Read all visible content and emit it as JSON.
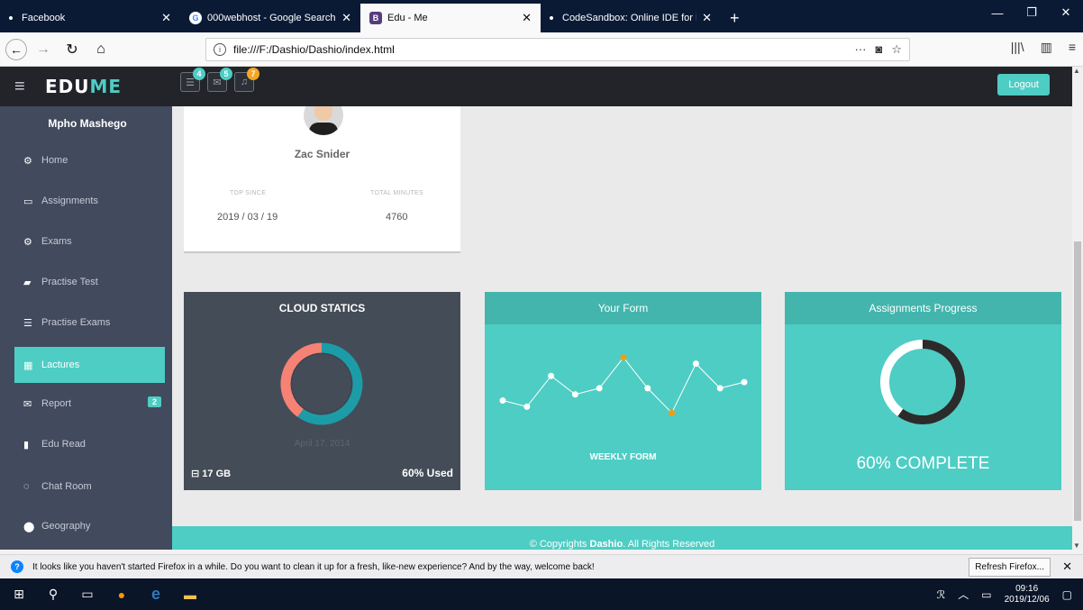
{
  "browser": {
    "tabs": [
      {
        "title": "Facebook",
        "active": false
      },
      {
        "title": "000webhost - Google Search",
        "active": false
      },
      {
        "title": "Edu - Me",
        "active": true
      },
      {
        "title": "CodeSandbox: Online IDE for R",
        "active": false
      }
    ],
    "url": "file:///F:/Dashio/Dashio/index.html"
  },
  "app": {
    "logo_main": "EDU",
    "logo_accent": "ME",
    "notifications": [
      {
        "icon": "tasks-icon",
        "count": "4",
        "color": "#4ecdc4"
      },
      {
        "icon": "envelope-icon",
        "count": "5",
        "color": "#4ecdc4"
      },
      {
        "icon": "bell-icon",
        "count": "7",
        "color": "#f5a623"
      }
    ],
    "logout_label": "Logout"
  },
  "sidebar": {
    "user_name": "Mpho Mashego",
    "items": [
      {
        "label": "Home",
        "icon": "dashboard-icon",
        "glyph": "⚙",
        "active": false
      },
      {
        "label": "Assignments",
        "icon": "desktop-icon",
        "glyph": "▭",
        "active": false
      },
      {
        "label": "Exams",
        "icon": "cogs-icon",
        "glyph": "⚙",
        "active": false
      },
      {
        "label": "Practise Test",
        "icon": "book-icon",
        "glyph": "▰",
        "active": false
      },
      {
        "label": "Practise Exams",
        "icon": "list-icon",
        "glyph": "☰",
        "active": false
      },
      {
        "label": "Lactures",
        "icon": "grid-icon",
        "glyph": "▦",
        "active": true
      },
      {
        "label": "Report",
        "icon": "envelope-icon",
        "glyph": "✉",
        "active": false,
        "badge": "2"
      },
      {
        "label": "Edu Read",
        "icon": "bar-chart-icon",
        "glyph": "▮",
        "active": false
      },
      {
        "label": "Chat Room",
        "icon": "comments-icon",
        "glyph": "◌",
        "active": false
      },
      {
        "label": "Geography",
        "icon": "map-marker-icon",
        "glyph": "⬤",
        "active": false
      }
    ]
  },
  "profile_card": {
    "name": "Zac Snider",
    "stats": [
      {
        "label": "TOP SINCE",
        "value": "2019 / 03 / 19"
      },
      {
        "label": "TOTAL MINUTES",
        "value": "4760"
      }
    ]
  },
  "cloud_panel": {
    "title": "CLOUD STATICS",
    "date": "April 17, 2014",
    "storage": "17 GB",
    "used": "60% Used",
    "used_fraction": 0.6,
    "used_color": "#1c9ca7",
    "free_color": "#f68275"
  },
  "form_panel": {
    "title": "Your Form",
    "caption": "WEEKLY FORM",
    "points": [
      3,
      2,
      7,
      4,
      5,
      10,
      5,
      1,
      9,
      5,
      6
    ],
    "highlight_indices": [
      5,
      7
    ],
    "highlight_color": "#f39c12"
  },
  "progress_panel": {
    "title": "Assignments Progress",
    "caption": "60% COMPLETE",
    "fraction": 0.6
  },
  "footer": {
    "prefix": "© Copyrights",
    "brand": "Dashio",
    "suffix": ". All Rights Reserved"
  },
  "notification_bar": {
    "message": "It looks like you haven't started Firefox in a while. Do you want to clean it up for a fresh, like-new experience? And by the way, welcome back!",
    "button": "Refresh Firefox..."
  },
  "taskbar": {
    "time": "09:16",
    "date": "2019/12/06"
  }
}
